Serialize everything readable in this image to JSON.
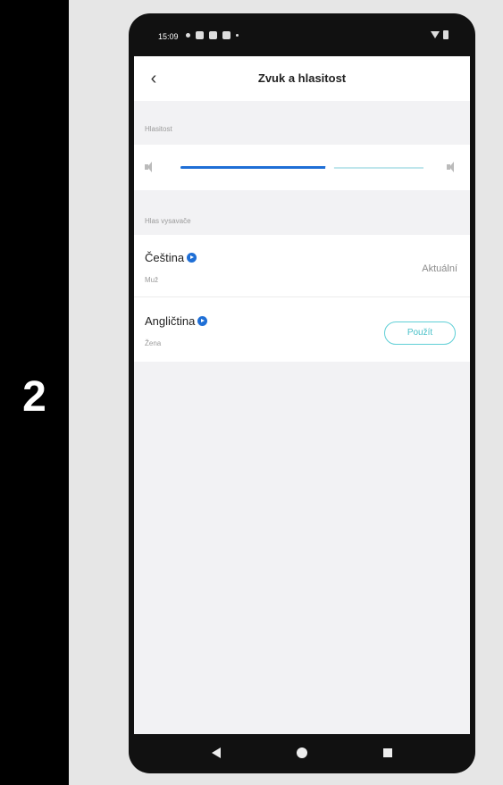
{
  "step": {
    "number": "2"
  },
  "status_bar": {
    "time": "15:09",
    "icons": [
      "notification-dot-icon",
      "app-icon",
      "settings-icon",
      "message-icon",
      "small-dot-icon"
    ],
    "right_icons": [
      "wifi-icon",
      "battery-icon"
    ]
  },
  "header": {
    "back_icon": "chevron-left-icon",
    "title": "Zvuk a hlasitost"
  },
  "volume": {
    "label": "Hlasitost",
    "level": 0.6,
    "min_icon": "volume-low-icon",
    "max_icon": "volume-high-icon",
    "fill_color": "#1f6fd6",
    "track_color": "#bfe6ec"
  },
  "voices": {
    "label": "Hlas vysavače",
    "items": [
      {
        "name": "Čeština",
        "sub": "Muž",
        "status": "Aktuální"
      },
      {
        "name": "Angličtina",
        "sub": "Žena",
        "action": "Použít"
      }
    ],
    "accent_color": "#1f6fd6",
    "button_color": "#48c0c8"
  },
  "nav_bar": {
    "icons": [
      "back-triangle-icon",
      "home-circle-icon",
      "recent-square-icon"
    ]
  }
}
